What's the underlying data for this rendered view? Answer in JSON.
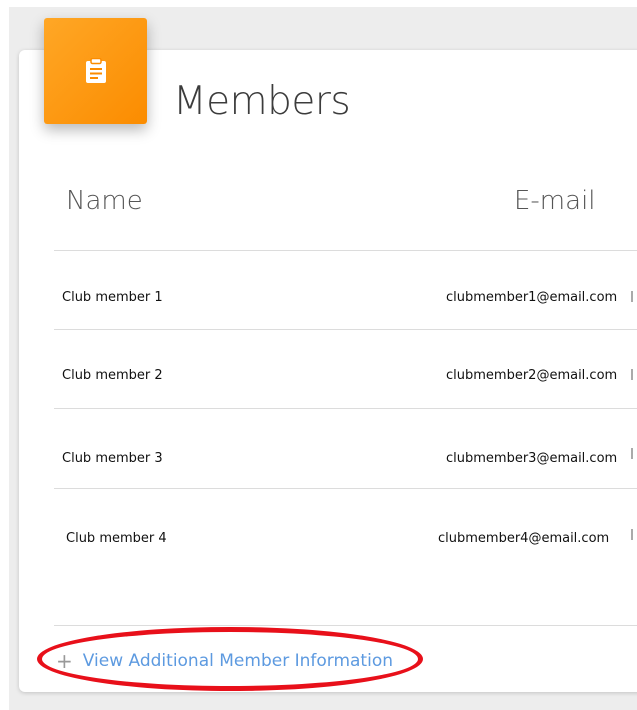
{
  "card": {
    "title": "Members",
    "icon": "clipboard-icon",
    "accent_color": "#fb8c00"
  },
  "table": {
    "columns": [
      "Name",
      "E-mail"
    ],
    "rows": [
      {
        "name": "Club member 1",
        "email": "clubmember1@email.com"
      },
      {
        "name": "Club member 2",
        "email": "clubmember2@email.com"
      },
      {
        "name": "Club member 3",
        "email": "clubmember3@email.com"
      },
      {
        "name": "Club member 4",
        "email": "clubmember4@email.com"
      }
    ]
  },
  "footer": {
    "link_label": "View Additional Member Information",
    "link_icon": "plus-icon",
    "link_color": "#5d9ae0",
    "annotation_color": "#e8101a"
  }
}
